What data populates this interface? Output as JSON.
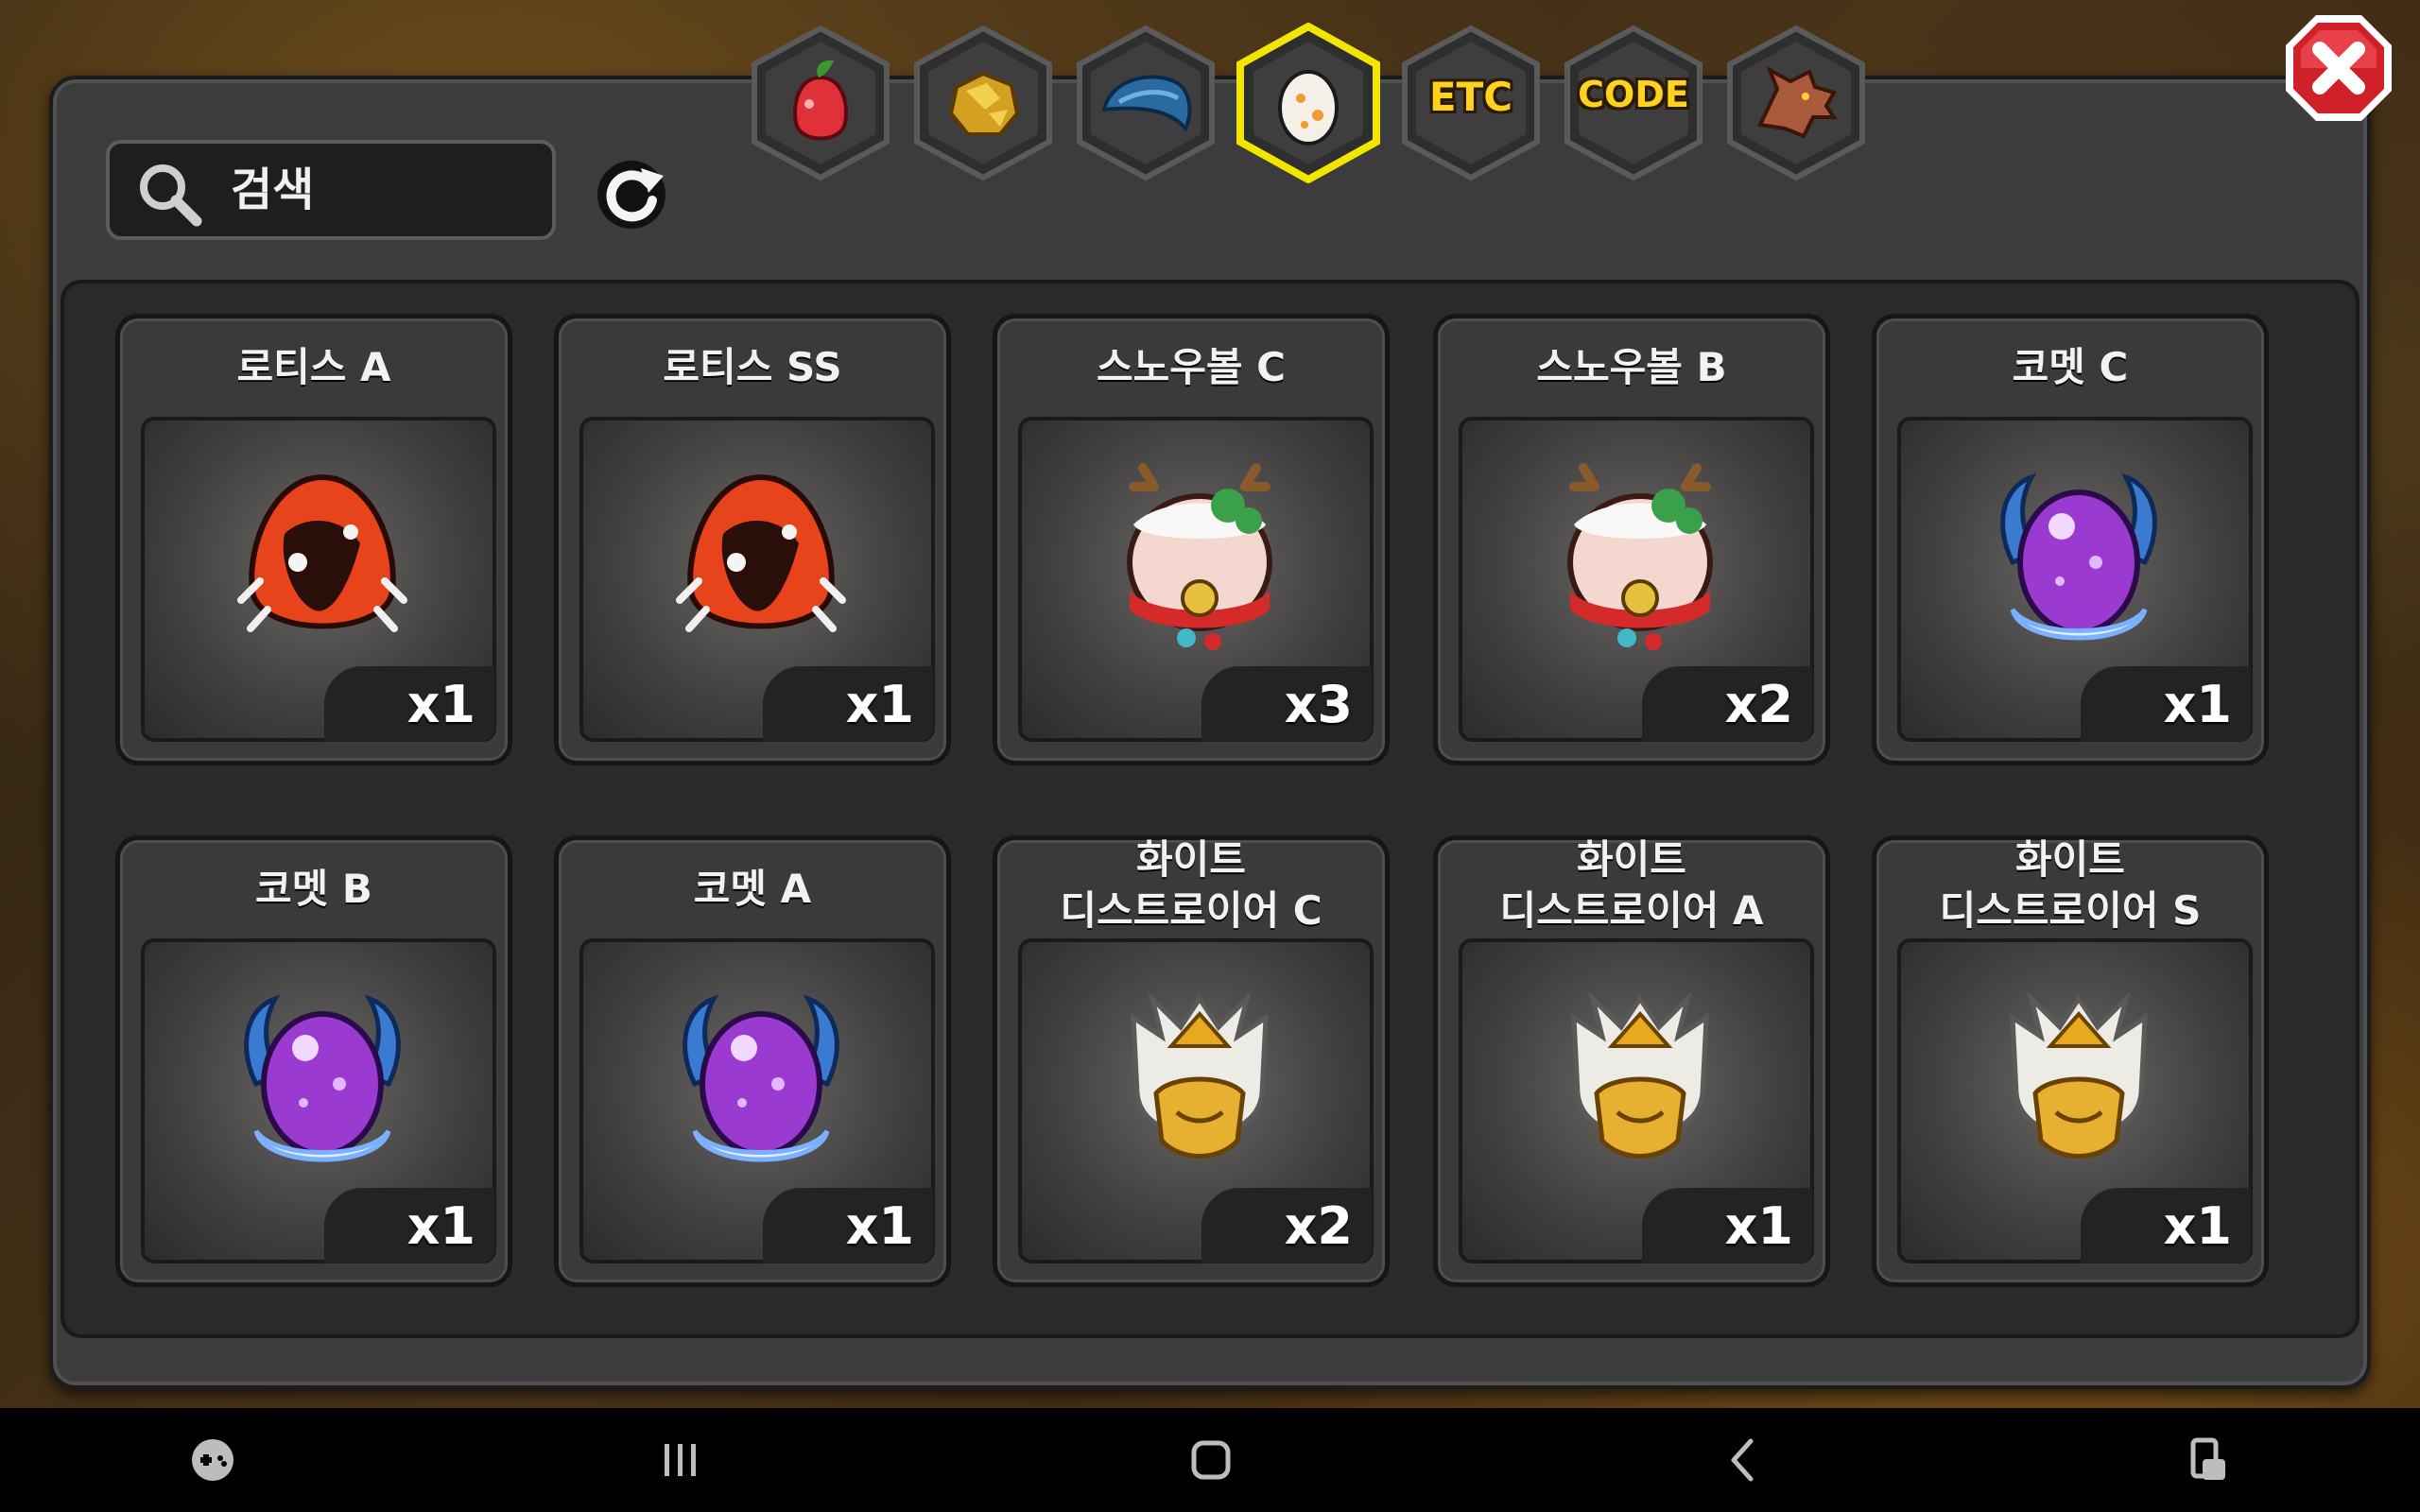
{
  "search": {
    "placeholder": "검색",
    "value": ""
  },
  "tabs": [
    {
      "name": "fruit",
      "icon": "fruit-icon",
      "label": ""
    },
    {
      "name": "gold",
      "icon": "gold-ore-icon",
      "label": ""
    },
    {
      "name": "scale",
      "icon": "dragon-scale-icon",
      "label": ""
    },
    {
      "name": "egg",
      "icon": "egg-icon",
      "label": "",
      "selected": true
    },
    {
      "name": "etc",
      "icon": "",
      "label": "ETC"
    },
    {
      "name": "code",
      "icon": "",
      "label": "CODE"
    },
    {
      "name": "dragon",
      "icon": "dragon-head-icon",
      "label": ""
    }
  ],
  "items": [
    {
      "name": "로티스 A",
      "count": "x1",
      "icon": "lotis-egg-icon"
    },
    {
      "name": "로티스 SS",
      "count": "x1",
      "icon": "lotis-egg-icon"
    },
    {
      "name": "스노우볼 C",
      "count": "x3",
      "icon": "snowball-egg-icon"
    },
    {
      "name": "스노우볼 B",
      "count": "x2",
      "icon": "snowball-egg-icon"
    },
    {
      "name": "코멧 C",
      "count": "x1",
      "icon": "comet-egg-icon"
    },
    {
      "name": "코멧 B",
      "count": "x1",
      "icon": "comet-egg-icon"
    },
    {
      "name": "코멧 A",
      "count": "x1",
      "icon": "comet-egg-icon"
    },
    {
      "name": "화이트\n디스트로이어 C",
      "count": "x2",
      "icon": "white-destroyer-egg-icon"
    },
    {
      "name": "화이트\n디스트로이어 A",
      "count": "x1",
      "icon": "white-destroyer-egg-icon"
    },
    {
      "name": "화이트\n디스트로이어 S",
      "count": "x1",
      "icon": "white-destroyer-egg-icon"
    }
  ],
  "colors": {
    "selected_tab_border": "#f2e600",
    "tab_label": "#ffd21e",
    "close_button": "#d0202a"
  },
  "navbar": {
    "buttons": [
      "game-tools-icon",
      "recent-apps-icon",
      "home-icon",
      "back-icon",
      "screen-rotate-icon"
    ]
  }
}
